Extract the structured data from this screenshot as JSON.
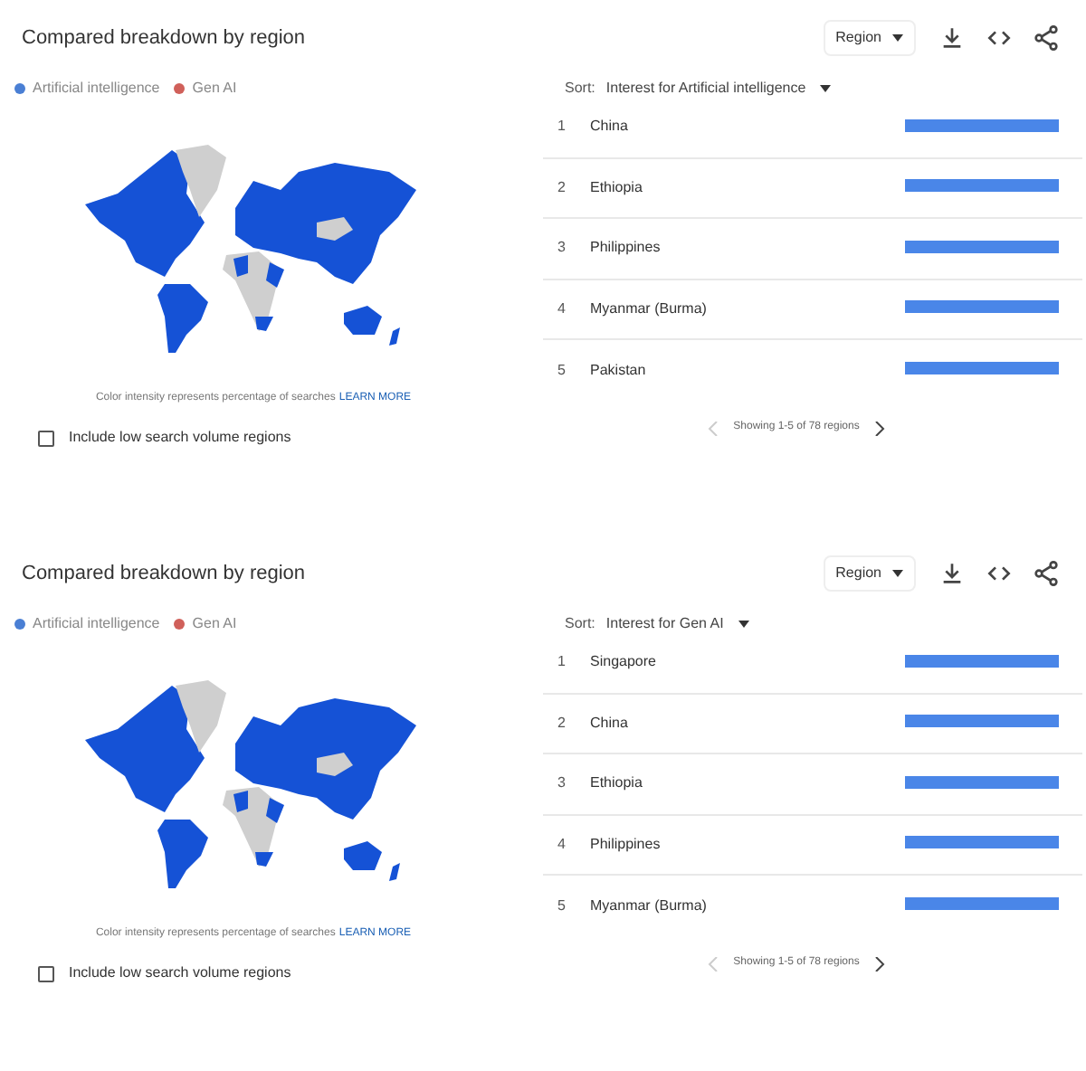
{
  "panels": [
    {
      "title": "Compared breakdown by region",
      "dropdown": "Region",
      "legend": [
        {
          "label": "Artificial intelligence",
          "color": "#4a7fd4"
        },
        {
          "label": "Gen AI",
          "color": "#d0605a"
        }
      ],
      "map_caption": "Color intensity represents percentage of searches",
      "map_link": "LEARN MORE",
      "checkbox": {
        "label": "Include low search volume regions",
        "checked": false
      },
      "sort_label": "Sort:",
      "sort_value": "Interest for Artificial intelligence",
      "rows": [
        {
          "rank": "1",
          "name": "China"
        },
        {
          "rank": "2",
          "name": "Ethiopia"
        },
        {
          "rank": "3",
          "name": "Philippines"
        },
        {
          "rank": "4",
          "name": "Myanmar (Burma)"
        },
        {
          "rank": "5",
          "name": "Pakistan"
        }
      ],
      "pagination": "Showing 1-5 of 78 regions"
    },
    {
      "title": "Compared breakdown by region",
      "dropdown": "Region",
      "legend": [
        {
          "label": "Artificial intelligence",
          "color": "#4a7fd4"
        },
        {
          "label": "Gen AI",
          "color": "#d0605a"
        }
      ],
      "map_caption": "Color intensity represents percentage of searches",
      "map_link": "LEARN MORE",
      "checkbox": {
        "label": "Include low search volume regions",
        "checked": false
      },
      "sort_label": "Sort:",
      "sort_value": "Interest for Gen AI",
      "rows": [
        {
          "rank": "1",
          "name": "Singapore"
        },
        {
          "rank": "2",
          "name": "China"
        },
        {
          "rank": "3",
          "name": "Ethiopia"
        },
        {
          "rank": "4",
          "name": "Philippines"
        },
        {
          "rank": "5",
          "name": "Myanmar (Burma)"
        }
      ],
      "pagination": "Showing 1-5 of 78 regions"
    }
  ]
}
